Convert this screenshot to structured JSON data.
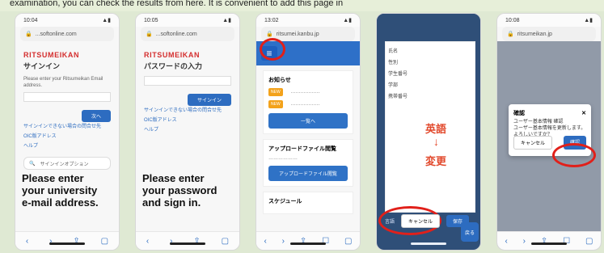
{
  "top_text": "examination, you can check the results from here. It is convenient to add this page in",
  "phones": [
    {
      "status_time": "10:04",
      "url": "...softonline.com",
      "logo": "RITSUMEIKAN",
      "title": "サインイン",
      "subtitle": "Please enter your Ritsumeikan Email address.",
      "btn": "次へ",
      "links": [
        "サインインできない場合の問合せ先",
        "OIC版アドレス",
        "ヘルプ"
      ],
      "search": "サインインオプション",
      "caption_lines": [
        "Please enter",
        "your university",
        "e-mail address."
      ]
    },
    {
      "status_time": "10:05",
      "url": "...softonline.com",
      "logo": "RITSUMEIKAN",
      "title": "パスワードの入力",
      "btn": "サインイン",
      "links": [
        "サインインできない場合の問合せ先",
        "OIC版アドレス",
        "ヘルプ"
      ],
      "caption_lines": [
        "Please enter",
        "your password",
        "and sign in."
      ]
    },
    {
      "status_time": "13:02",
      "url": "ritsumei.kanbu.jp",
      "section1": "お知らせ",
      "tags": [
        "NEW",
        "NEW"
      ],
      "btn1": "一覧へ",
      "section2": "アップロードファイル閲覧",
      "btn2": "アップロードファイル閲覧",
      "section3": "スケジュール"
    },
    {
      "labels": [
        "氏名",
        "性別",
        "学生番号",
        "学部",
        "携帯番号"
      ],
      "jp_text_1": "英語",
      "arrow": "↓",
      "jp_text_2": "変更",
      "bottom_label": "言語",
      "cancel": "キャンセル",
      "save": "保存",
      "float": "戻る"
    },
    {
      "status_time": "10:08",
      "url": "ritsumeikan.jp",
      "modal_title": "確認",
      "modal_text": "ユーザー基本情報 確認",
      "modal_text2": "ユーザー基本情報を更新します。よろしいですか？",
      "cancel": "キャンセル",
      "ok": "確認"
    }
  ]
}
